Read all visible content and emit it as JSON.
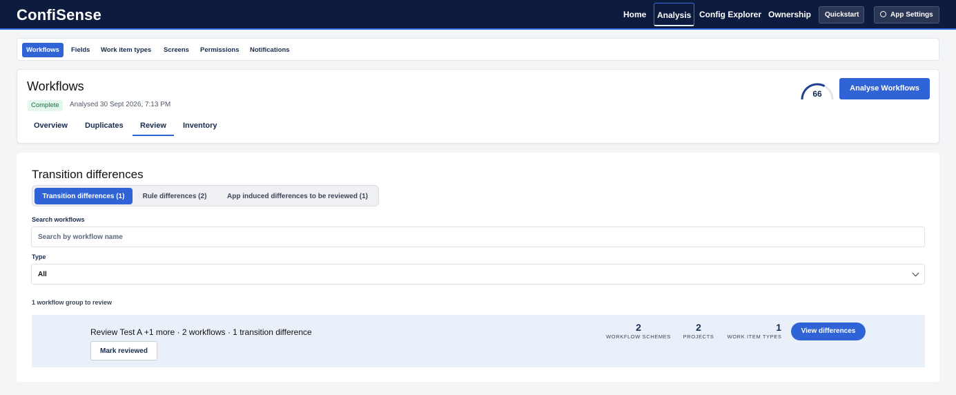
{
  "app": {
    "brand": "ConfiSense"
  },
  "topnav": {
    "links": [
      "Home",
      "Analysis",
      "Config Explorer",
      "Ownership"
    ],
    "quickstart": "Quickstart",
    "app_settings": "App Settings"
  },
  "subnav": [
    "Workflows",
    "Fields",
    "Work item types",
    "Screens",
    "Permissions",
    "Notifications"
  ],
  "header": {
    "title": "Workflows",
    "status": "Complete",
    "analysed": "Analysed 30 Sept 2026, 7:13 PM",
    "tabs": [
      "Overview",
      "Duplicates",
      "Review",
      "Inventory"
    ],
    "active_tab": "Review",
    "score": "66",
    "score_fraction": 0.66,
    "analyse_button": "Analyse Workflows"
  },
  "panel": {
    "title": "Transition differences",
    "segments": [
      "Transition differences (1)",
      "Rule differences (2)",
      "App induced differences to be reviewed (1)"
    ],
    "search_label": "Search workflows",
    "search_placeholder": "Search by workflow name",
    "type_label": "Type",
    "type_value": "All",
    "group_count": "1 workflow group to review",
    "group": {
      "title": "Review Test A +1 more · 2 workflows · 1 transition difference",
      "mark_button": "Mark reviewed",
      "stats": [
        {
          "value": "2",
          "label": "WORKFLOW SCHEMES"
        },
        {
          "value": "2",
          "label": "PROJECTS"
        },
        {
          "value": "1",
          "label": "WORK ITEM TYPES"
        }
      ],
      "view_button": "View differences"
    }
  },
  "colors": {
    "nav_bg": "#0d1b3e",
    "accent": "#2f63d6",
    "badge_bg": "#e3f7ec"
  }
}
